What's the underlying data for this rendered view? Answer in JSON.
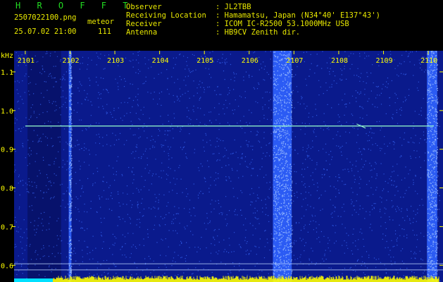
{
  "header": {
    "title": "H R O F F T",
    "filename": "2507022100.png",
    "datetime": "25.07.02 21:00",
    "meteor_label": "meteor",
    "meteor_count": "111",
    "fields": [
      {
        "label": "Observer",
        "value": ": JL2TBB"
      },
      {
        "label": "Receiving Location",
        "value": ": Hamamatsu, Japan (N34°40' E137°43')"
      },
      {
        "label": "Receiver",
        "value": ": ICOM IC-R2500 53.1000MHz USB"
      },
      {
        "label": "Antenna",
        "value": ": HB9CV Zenith dir."
      }
    ]
  },
  "chart_data": {
    "type": "heatmap",
    "ylabel": "kHz",
    "y_ticks": [
      "1.1",
      "1.0",
      "0.9",
      "0.8",
      "0.7",
      "0.6"
    ],
    "y_tick_values": [
      1.1,
      1.0,
      0.9,
      0.8,
      0.7,
      0.6
    ],
    "ylim": [
      0.575,
      1.14
    ],
    "x_ticks": [
      "2101",
      "2102",
      "2103",
      "2104",
      "2105",
      "2106",
      "2107",
      "2108",
      "2109",
      "2110"
    ],
    "xlim": [
      2100.75,
      2110.25
    ],
    "trace_level_khz": 0.96,
    "bright_bands": [
      {
        "from": 2101.97,
        "to": 2102.03
      },
      {
        "from": 2106.53,
        "to": 2106.95
      },
      {
        "from": 2109.97,
        "to": 2110.2
      }
    ],
    "dark_band": {
      "from": 2101.05,
      "to": 2101.8
    },
    "colors": {
      "background": "#0a1a8c",
      "noise": "#3a6cff",
      "trace": "#99ffcc",
      "ticks": "#ffff00",
      "footer": "#ffff00",
      "footer_alt": "#00e0ff"
    }
  }
}
